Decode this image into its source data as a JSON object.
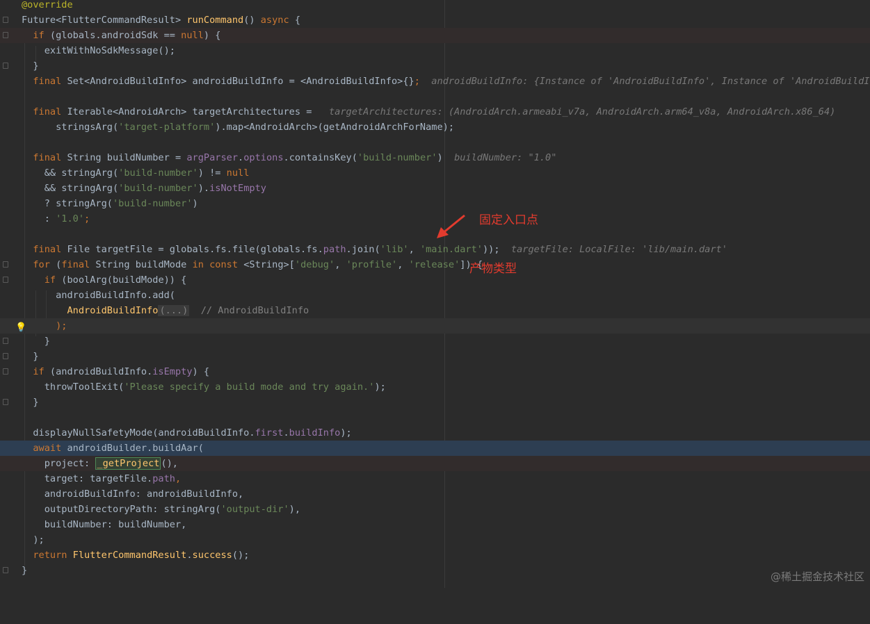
{
  "editor": {
    "lines": {
      "l1": {
        "t0": "@override"
      },
      "l2": {
        "t0": "Future<FlutterCommandResult> ",
        "t1": "runCommand",
        "t2": "() ",
        "t3": "async",
        "t4": " {"
      },
      "l3": {
        "t0": "  ",
        "t1": "if",
        "t2": " (globals.androidSdk == ",
        "t3": "null",
        "t4": ") {"
      },
      "l4": {
        "t0": "    exitWithNoSdkMessage();"
      },
      "l5": {
        "t0": "  }"
      },
      "l6": {
        "t0": "  ",
        "t1": "final",
        "t2": " Set<AndroidBuildInfo> androidBuildInfo = <AndroidBuildInfo>{}",
        "t3": ";",
        "hint": "androidBuildInfo: {Instance of 'AndroidBuildInfo', Instance of 'AndroidBuildInfo', I"
      },
      "l8": {
        "t0": "  ",
        "t1": "final",
        "t2": " Iterable<AndroidArch> targetArchitectures = ",
        "hint": "targetArchitectures: (AndroidArch.armeabi_v7a, AndroidArch.arm64_v8a, AndroidArch.x86_64)"
      },
      "l9": {
        "t0": "      stringsArg(",
        "t1": "'target-platform'",
        "t2": ").map<AndroidArch>(getAndroidArchForName);"
      },
      "l11": {
        "t0": "  ",
        "t1": "final",
        "t2": " String buildNumber = ",
        "t3": "argParser",
        "t4": ".",
        "t5": "options",
        "t6": ".containsKey(",
        "t7": "'build-number'",
        "t8": ")",
        "hint": "buildNumber: \"1.0\""
      },
      "l12": {
        "t0": "    && stringArg(",
        "t1": "'build-number'",
        "t2": ") != ",
        "t3": "null"
      },
      "l13": {
        "t0": "    && stringArg(",
        "t1": "'build-number'",
        "t2": ").",
        "t3": "isNotEmpty"
      },
      "l14": {
        "t0": "    ? stringArg(",
        "t1": "'build-number'",
        "t2": ")"
      },
      "l15": {
        "t0": "    : ",
        "t1": "'1.0'",
        "t2": ";"
      },
      "l17": {
        "t0": "  ",
        "t1": "final",
        "t2": " File targetFile = globals.fs.file(globals.fs.",
        "t3": "path",
        "t4": ".join(",
        "t5": "'lib'",
        "t6": ", ",
        "t7": "'main.dart'",
        "t8": "));",
        "hint": "targetFile: LocalFile: 'lib/main.dart'"
      },
      "l18": {
        "t0": "  ",
        "t1": "for",
        "t2": " (",
        "t3": "final",
        "t4": " String buildMode ",
        "t5": "in",
        "t6": " ",
        "t7": "const",
        "t8": " <String>[",
        "t9": "'debug'",
        "t10": ", ",
        "t11": "'profile'",
        "t12": ", ",
        "t13": "'release'",
        "t14": "]) {"
      },
      "l19": {
        "t0": "    ",
        "t1": "if",
        "t2": " (boolArg(buildMode)) {"
      },
      "l20": {
        "t0": "      androidBuildInfo.add("
      },
      "l21": {
        "t0": "        ",
        "t1": "AndroidBuildInfo",
        "t2": "(...)",
        "t3": "  // AndroidBuildInfo"
      },
      "l22": {
        "t0": "      );"
      },
      "l23": {
        "t0": "    }"
      },
      "l24": {
        "t0": "  }"
      },
      "l25": {
        "t0": "  ",
        "t1": "if",
        "t2": " (androidBuildInfo.",
        "t3": "isEmpty",
        "t4": ") {"
      },
      "l26": {
        "t0": "    throwToolExit(",
        "t1": "'Please specify a build mode and try again.'",
        "t2": ");"
      },
      "l27": {
        "t0": "  }"
      },
      "l29": {
        "t0": "  displayNullSafetyMode(androidBuildInfo.",
        "t1": "first",
        "t2": ".",
        "t3": "buildInfo",
        "t4": ");"
      },
      "l30": {
        "t0": "  ",
        "t1": "await",
        "t2": " androidBuilder.buildAar("
      },
      "l31": {
        "t0": "    project: ",
        "t1": "_getProject",
        "t2": "(),"
      },
      "l32": {
        "t0": "    target: targetFile.",
        "t1": "path",
        "t2": ","
      },
      "l33": {
        "t0": "    androidBuildInfo: androidBuildInfo,"
      },
      "l34": {
        "t0": "    outputDirectoryPath: stringArg(",
        "t1": "'output-dir'",
        "t2": "),"
      },
      "l35": {
        "t0": "    buildNumber: buildNumber,"
      },
      "l36": {
        "t0": "  );"
      },
      "l37": {
        "t0": "  ",
        "t1": "return",
        "t2": " ",
        "t3": "FlutterCommandResult",
        "t4": ".",
        "t5": "success",
        "t6": "();"
      },
      "l38": {
        "t0": "}"
      }
    }
  },
  "annotations": {
    "entry_point": "固定入口点",
    "build_type": "产物类型"
  },
  "watermark": "@稀土掘金技术社区",
  "colors": {
    "background": "#2b2b2b",
    "keyword": "#cc7832",
    "annotation": "#bbb529",
    "function": "#ffc66d",
    "string": "#6a8759",
    "field": "#9876aa",
    "inlay_hint": "#787878",
    "red_annotation": "#e23b2e",
    "debug_line": "#2d3e52"
  }
}
